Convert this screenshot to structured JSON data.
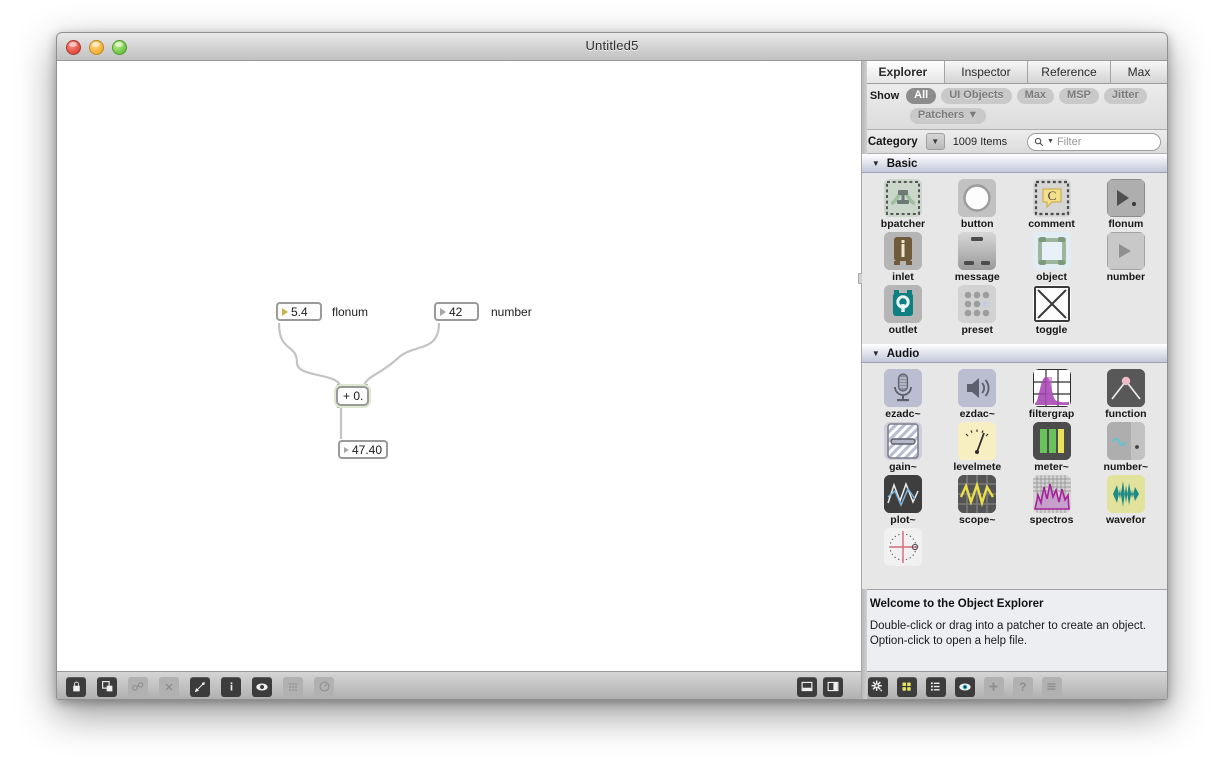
{
  "window": {
    "title": "Untitled5",
    "traffic_lights": [
      "close",
      "minimize",
      "zoom"
    ]
  },
  "patcher": {
    "objects": [
      {
        "kind": "flonum",
        "value": "5.4"
      },
      {
        "kind": "number",
        "value": "42"
      },
      {
        "kind": "object",
        "value": "+ 0."
      },
      {
        "kind": "flonum",
        "value": "47.40"
      }
    ],
    "comments": [
      {
        "text": "flonum"
      },
      {
        "text": "number"
      }
    ],
    "toolbar_left": [
      {
        "name": "lock-icon",
        "label": "Lock",
        "enabled": true
      },
      {
        "name": "presentation-icon",
        "label": "Presentation Mode",
        "enabled": true
      },
      {
        "name": "inspector-icon",
        "label": "Inspector",
        "enabled": false
      },
      {
        "name": "delete-icon",
        "label": "Delete",
        "enabled": false
      },
      {
        "name": "sidebar-object-icon",
        "label": "Object Explorer",
        "enabled": true
      },
      {
        "name": "info-icon",
        "label": "Info",
        "enabled": true
      },
      {
        "name": "hide-icon",
        "label": "Hidden Objects",
        "enabled": true
      },
      {
        "name": "grid-icon",
        "label": "Grid",
        "enabled": false
      },
      {
        "name": "snap-icon",
        "label": "Snap to Grid",
        "enabled": false
      }
    ],
    "toolbar_right": [
      {
        "name": "panel-bottom-icon",
        "label": "Show Bottom Panel"
      },
      {
        "name": "panel-side-icon",
        "label": "Show Side Panel"
      }
    ]
  },
  "sidebar": {
    "tabs": [
      {
        "label": "Explorer",
        "active": true
      },
      {
        "label": "Inspector",
        "active": false
      },
      {
        "label": "Reference",
        "active": false
      },
      {
        "label": "Max",
        "active": false
      }
    ],
    "show": {
      "label": "Show",
      "filters": [
        {
          "label": "All",
          "active": true
        },
        {
          "label": "UI Objects",
          "active": false
        },
        {
          "label": "Max",
          "active": false
        },
        {
          "label": "MSP",
          "active": false
        },
        {
          "label": "Jitter",
          "active": false
        }
      ],
      "patchers": {
        "label": "Patchers ▼"
      }
    },
    "category_bar": {
      "label": "Category",
      "dropdown_glyph": "▼",
      "item_count": "1009 Items",
      "search_placeholder": "Filter",
      "search_value": ""
    },
    "sections": [
      {
        "title": "Basic",
        "expanded": true,
        "items": [
          {
            "label": "bpatcher",
            "icon": "bpatcher-icon"
          },
          {
            "label": "button",
            "icon": "button-icon"
          },
          {
            "label": "comment",
            "icon": "comment-icon"
          },
          {
            "label": "flonum",
            "icon": "flonum-icon"
          },
          {
            "label": "inlet",
            "icon": "inlet-icon"
          },
          {
            "label": "message",
            "icon": "message-icon"
          },
          {
            "label": "object",
            "icon": "object-icon"
          },
          {
            "label": "number",
            "icon": "number-icon"
          },
          {
            "label": "outlet",
            "icon": "outlet-icon"
          },
          {
            "label": "preset",
            "icon": "preset-icon"
          },
          {
            "label": "toggle",
            "icon": "toggle-icon"
          }
        ]
      },
      {
        "title": "Audio",
        "expanded": true,
        "items": [
          {
            "label": "ezadc~",
            "icon": "ezadc-icon"
          },
          {
            "label": "ezdac~",
            "icon": "ezdac-icon"
          },
          {
            "label": "filtergrap",
            "icon": "filtergraph-icon"
          },
          {
            "label": "function",
            "icon": "function-icon"
          },
          {
            "label": "gain~",
            "icon": "gain-icon"
          },
          {
            "label": "levelmete",
            "icon": "levelmeter-icon"
          },
          {
            "label": "meter~",
            "icon": "meter-icon"
          },
          {
            "label": "number~",
            "icon": "numbertilde-icon"
          },
          {
            "label": "plot~",
            "icon": "plot-icon"
          },
          {
            "label": "scope~",
            "icon": "scope-icon"
          },
          {
            "label": "spectros",
            "icon": "spectroscope-icon"
          },
          {
            "label": "wavefor",
            "icon": "waveform-icon"
          },
          {
            "label": "",
            "icon": "radiogroup-icon"
          }
        ]
      }
    ],
    "info": {
      "title": "Welcome to the Object Explorer",
      "line1": "Double-click or drag into a patcher to create an object.",
      "line2": "Option-click to open a help file."
    },
    "toolbar": [
      {
        "name": "settings-gear-icon",
        "label": "Settings",
        "enabled": true
      },
      {
        "name": "grid-view-icon",
        "label": "Grid View",
        "enabled": true
      },
      {
        "name": "list-view-icon",
        "label": "List View",
        "enabled": true
      },
      {
        "name": "eye-icon",
        "label": "Preview",
        "enabled": true
      },
      {
        "name": "plus-icon",
        "label": "Add",
        "enabled": false
      },
      {
        "name": "help-icon",
        "label": "Help",
        "enabled": false
      },
      {
        "name": "menu-icon",
        "label": "Menu",
        "enabled": false
      }
    ]
  },
  "colors": {
    "accent_blue": "#c3c7da",
    "flonum_triangle": "#cdb347",
    "object_glow": "#dfe7cf",
    "teal": "#0e7f83",
    "canvas": "#ffffff"
  }
}
